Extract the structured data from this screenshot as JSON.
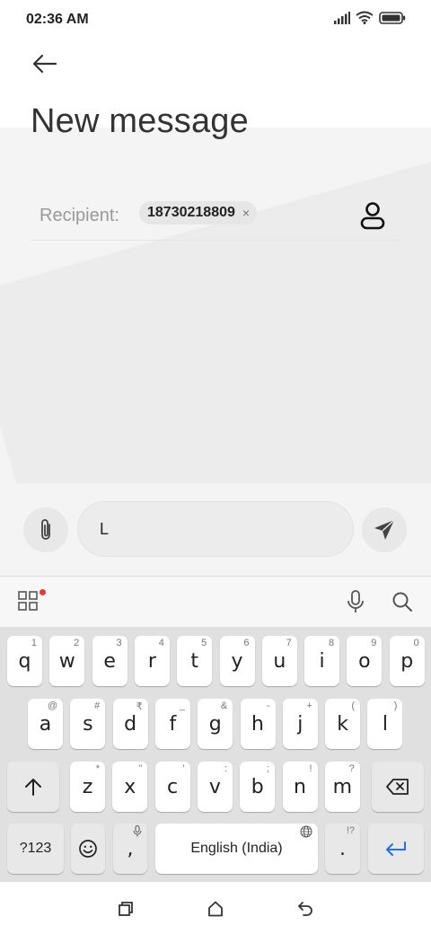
{
  "status": {
    "time": "02:36 AM",
    "icons": [
      "signal-icon",
      "wifi-icon",
      "battery-icon"
    ]
  },
  "header": {
    "title": "New message"
  },
  "recipient": {
    "label": "Recipient:",
    "chip": "18730218809",
    "chip_remove": "×"
  },
  "compose": {
    "input_value": "L"
  },
  "keyboard": {
    "row1": [
      {
        "key": "q",
        "hint": "1"
      },
      {
        "key": "w",
        "hint": "2"
      },
      {
        "key": "e",
        "hint": "3"
      },
      {
        "key": "r",
        "hint": "4"
      },
      {
        "key": "t",
        "hint": "5"
      },
      {
        "key": "y",
        "hint": "6"
      },
      {
        "key": "u",
        "hint": "7"
      },
      {
        "key": "i",
        "hint": "8"
      },
      {
        "key": "o",
        "hint": "9"
      },
      {
        "key": "p",
        "hint": "0"
      }
    ],
    "row2": [
      {
        "key": "a",
        "hint": "@"
      },
      {
        "key": "s",
        "hint": "#"
      },
      {
        "key": "d",
        "hint": "₹"
      },
      {
        "key": "f",
        "hint": "_"
      },
      {
        "key": "g",
        "hint": "&"
      },
      {
        "key": "h",
        "hint": "-"
      },
      {
        "key": "j",
        "hint": "+"
      },
      {
        "key": "k",
        "hint": "("
      },
      {
        "key": "l",
        "hint": ")"
      }
    ],
    "row3": [
      {
        "key": "z",
        "hint": "*"
      },
      {
        "key": "x",
        "hint": "\""
      },
      {
        "key": "c",
        "hint": "'"
      },
      {
        "key": "v",
        "hint": ":"
      },
      {
        "key": "b",
        "hint": ";"
      },
      {
        "key": "n",
        "hint": "!"
      },
      {
        "key": "m",
        "hint": "?"
      }
    ],
    "symbols_key": "?123",
    "comma_key": ",",
    "space_label": "English (India)",
    "period_key": ".",
    "period_hint": "!?"
  },
  "colors": {
    "accent": "#1a73e8",
    "notification_dot": "#e53935"
  }
}
